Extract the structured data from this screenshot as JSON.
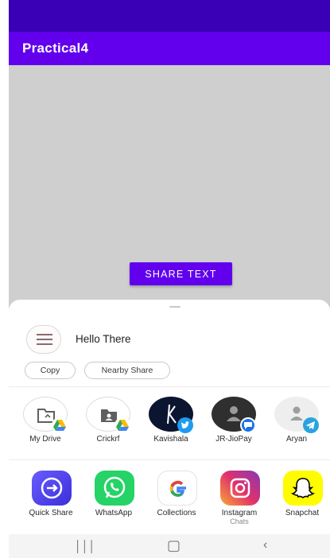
{
  "app": {
    "title": "Practical4"
  },
  "main": {
    "share_button_label": "SHARE TEXT"
  },
  "share_sheet": {
    "preview_text": "Hello There",
    "chips": [
      "Copy",
      "Nearby Share"
    ],
    "direct_targets": [
      {
        "label": "My Drive",
        "badge": "google-drive"
      },
      {
        "label": "Crickrf",
        "badge": "google-drive"
      },
      {
        "label": "Kavishala",
        "badge": "twitter"
      },
      {
        "label": "JR-JioPay",
        "badge": "messages"
      },
      {
        "label": "Aryan",
        "badge": "telegram"
      }
    ],
    "apps": [
      {
        "label": "Quick Share",
        "sublabel": ""
      },
      {
        "label": "WhatsApp",
        "sublabel": ""
      },
      {
        "label": "Collections",
        "sublabel": ""
      },
      {
        "label": "Instagram",
        "sublabel": "Chats"
      },
      {
        "label": "Snapchat",
        "sublabel": ""
      }
    ]
  },
  "colors": {
    "status_bar": "#3a00b6",
    "app_bar": "#6200ee",
    "button": "#6200ee",
    "content_background": "#cfcfcf"
  }
}
